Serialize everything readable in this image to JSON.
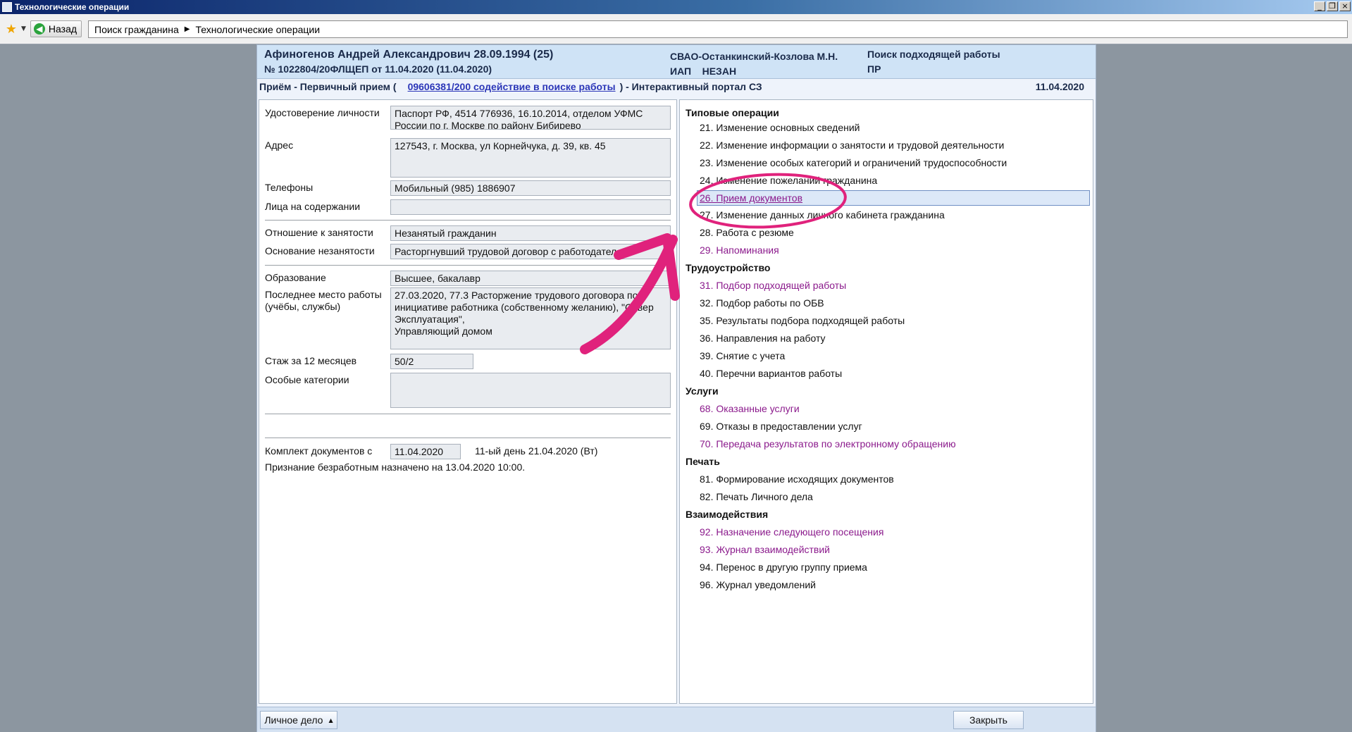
{
  "window": {
    "title": "Технологические операции"
  },
  "toolbar": {
    "back_label": "Назад",
    "breadcrumb": [
      "Поиск гражданина",
      "Технологические операции"
    ]
  },
  "header": {
    "name": "Афиногенов Андрей Александрович 28.09.1994 (25)",
    "number": "№ 1022804/20ФЛЩЕП от 11.04.2020 (11.04.2020)",
    "department": "СВАО-Останкинский-Козлова М.Н.",
    "iap": "ИАП    НЕЗАН",
    "search": "Поиск подходящей работы",
    "pr": "ПР"
  },
  "reception": {
    "prefix": "Приём - Первичный прием (",
    "link": "09606381/200 содействие в поиске работы",
    "suffix": ") - Интерактивный портал СЗ",
    "date": "11.04.2020"
  },
  "left": {
    "id_doc_label": "Удостоверение личности",
    "id_doc_value": "Паспорт РФ, 4514 776936, 16.10.2014, отделом УФМС России по г. Москве по району Бибирево",
    "address_label": "Адрес",
    "address_value": "127543, г. Москва, ул Корнейчука, д. 39, кв. 45",
    "phones_label": "Телефоны",
    "phones_value": "Мобильный (985) 1886907",
    "dependents_label": "Лица на содержании",
    "dependents_value": "",
    "employment_label": "Отношение к занятости",
    "employment_value": "Незанятый гражданин",
    "basis_label": "Основание незанятости",
    "basis_value": "Расторгнувший трудовой договор с работодателем",
    "education_label": "Образование",
    "education_value": "Высшее, бакалавр",
    "lastwork_label": "Последнее место работы (учёбы, службы)",
    "lastwork_value": "27.03.2020, 77.3 Расторжение трудового договора по инициативе работника (собственному желанию), \"Север Эксплуатация\",\nУправляющий домом",
    "stazh_label": "Стаж за 12 месяцев",
    "stazh_value": "50/2",
    "special_label": "Особые категории",
    "special_value": "",
    "docs_label": "Комплект документов с",
    "docs_value": "11.04.2020",
    "day_text": "11-ый день 21.04.2020 (Вт)",
    "recognition_text": "Признание безработным назначено на 13.04.2020 10:00."
  },
  "right": {
    "sec_typical": "Типовые операции",
    "op21": "21. Изменение основных сведений",
    "op22": "22. Изменение информации о занятости и трудовой деятельности",
    "op23": "23. Изменение особых категорий и ограничений трудоспособности",
    "op24": "24. Изменение пожеланий гражданина",
    "op26": "26. Прием документов",
    "op27": "27. Изменение данных личного кабинета гражданина",
    "op28": "28. Работа с резюме",
    "op29": "29. Напоминания",
    "sec_employment": "Трудоустройство",
    "op31": "31. Подбор подходящей работы",
    "op32": "32. Подбор работы по ОБВ",
    "op35": "35. Результаты подбора подходящей работы",
    "op36": "36. Направления на работу",
    "op39": "39. Снятие с учета",
    "op40": "40. Перечни вариантов работы",
    "sec_services": "Услуги",
    "op68": "68. Оказанные услуги",
    "op69": "69. Отказы в предоставлении услуг",
    "op70": "70. Передача результатов по электронному обращению",
    "sec_print": "Печать",
    "op81": "81. Формирование исходящих документов",
    "op82": "82. Печать Личного дела",
    "sec_interactions": "Взаимодействия",
    "op92": "92. Назначение следующего посещения",
    "op93": "93. Журнал взаимодействий",
    "op94": "94. Перенос в другую группу приема",
    "op96": "96. Журнал уведомлений"
  },
  "bottom": {
    "personal_file": "Личное дело",
    "close": "Закрыть"
  },
  "colors": {
    "annotation": "#e0227c",
    "link_purple": "#8b1a8c",
    "header_bg": "#cfe3f6"
  }
}
